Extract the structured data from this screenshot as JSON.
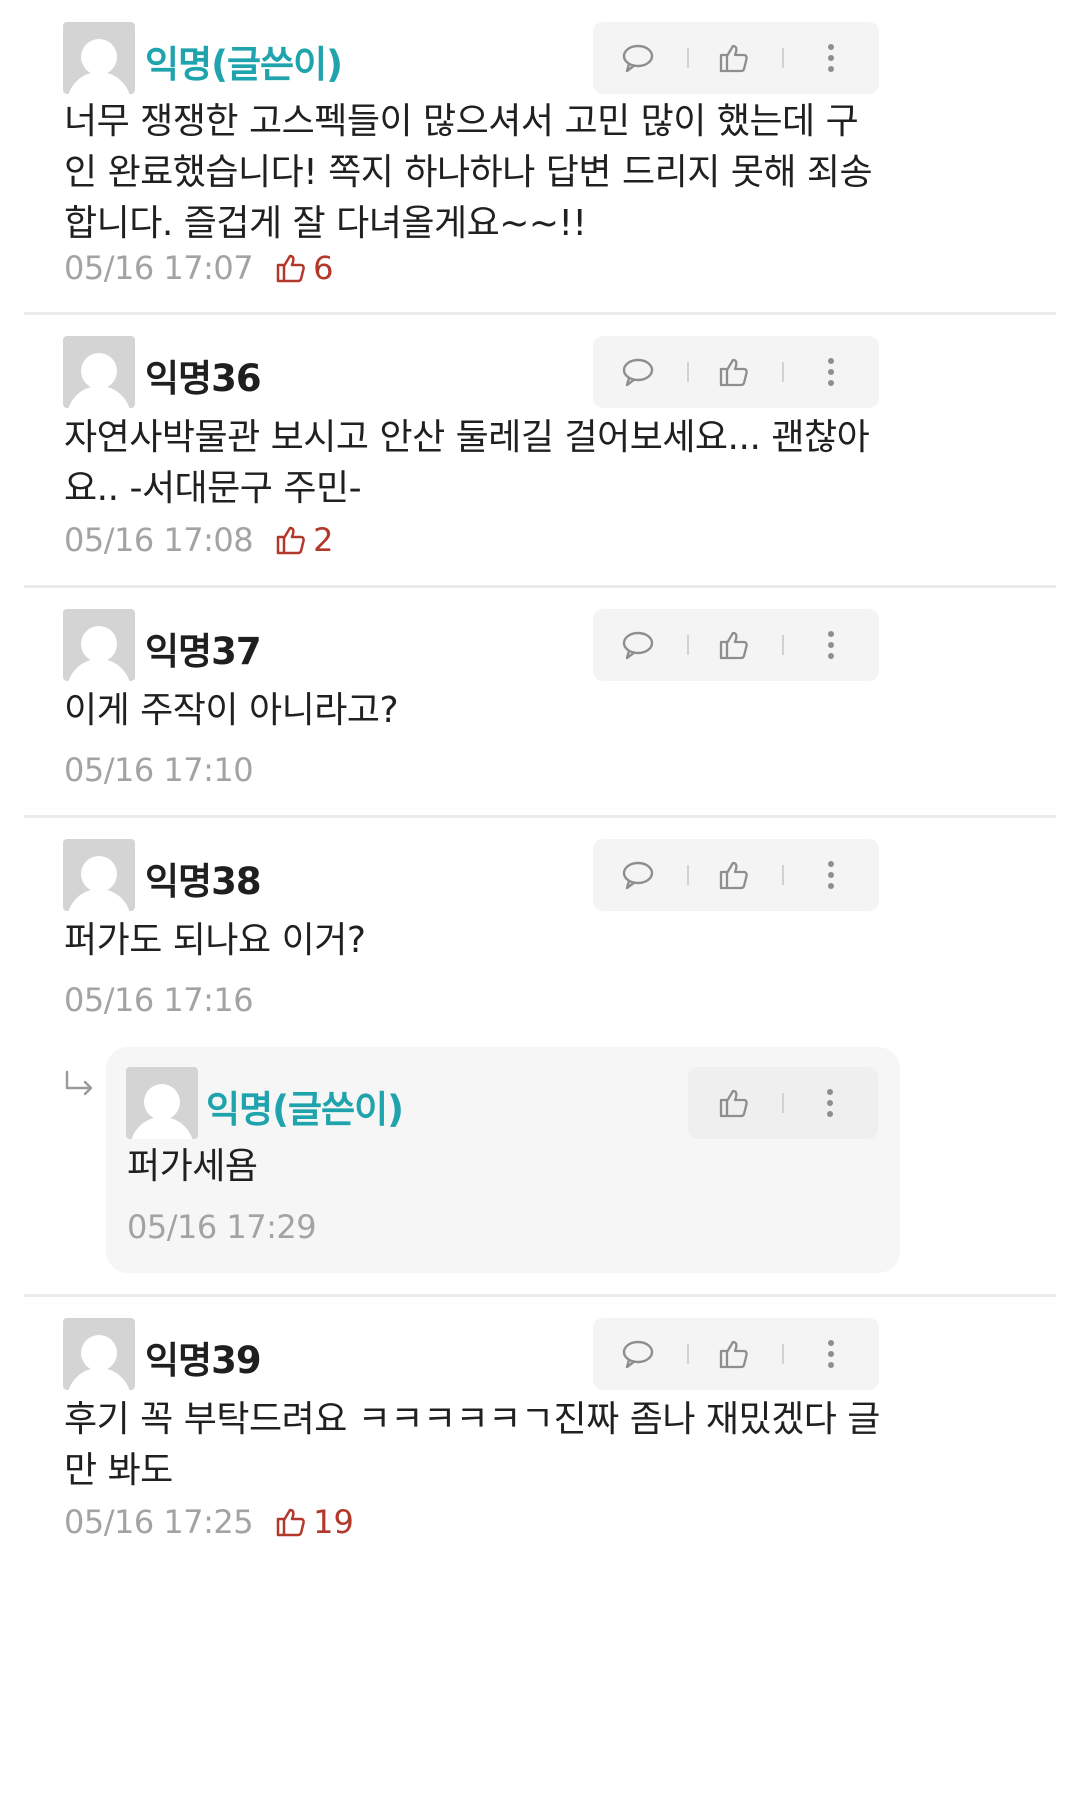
{
  "comments": [
    {
      "author": "익명(글쓴이)",
      "text": "너무 쟁쟁한 고스펙들이 많으셔서 고민 많이 했는데 구인 완료했습니다! 쪽지 하나하나 답변 드리지 못해 죄송합니다. 즐겁게 잘 다녀올게요~~!!",
      "time": "05/16 17:07",
      "likes": "6"
    },
    {
      "author": "익명36",
      "text": "자연사박물관 보시고 안산 둘레길 걸어보세요... 괜찮아요.. -서대문구 주민-",
      "time": "05/16 17:08",
      "likes": "2"
    },
    {
      "author": "익명37",
      "text": "이게 주작이 아니라고?",
      "time": "05/16 17:10"
    },
    {
      "author": "익명38",
      "text": "퍼가도 되나요 이거?",
      "time": "05/16 17:16"
    },
    {
      "author": "익명39",
      "text": "후기 꼭 부탁드려요 ㅋㅋㅋㅋㅋㄱ진짜 좀나 재밌겠다 글만 봐도",
      "time": "05/16 17:25",
      "likes": "19"
    }
  ],
  "reply": {
    "author": "익명(글쓴이)",
    "text": "퍼가세욤",
    "time": "05/16 17:29"
  },
  "icons": [
    "comment-icon",
    "thumbs-up-icon",
    "more-vertical-icon",
    "reply-arrow-icon"
  ],
  "colors": {
    "op_author": "#1fa3ac",
    "like_count": "#b2382a",
    "timestamp": "#a3a3a3"
  }
}
